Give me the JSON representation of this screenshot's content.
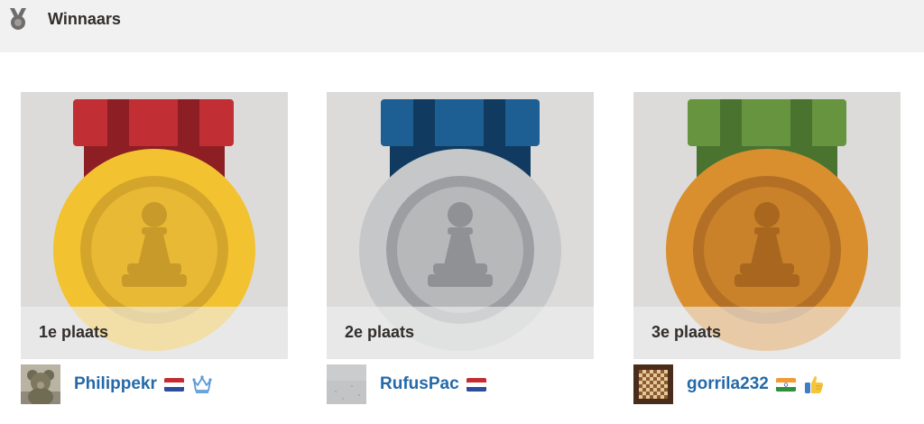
{
  "header": {
    "icon": "medal-icon",
    "title": "Winnaars"
  },
  "colors": {
    "gold": "#f0c23b",
    "silver": "#b9bcbf",
    "bronze": "#d9912f",
    "ribbon_red": "#c12e34",
    "ribbon_blue": "#1c5f93",
    "ribbon_green": "#66933f",
    "username_link": "#2469a8"
  },
  "winners": [
    {
      "place_label": "1e plaats",
      "medal": "gold-medal-pawn-icon",
      "username": "Philippekr",
      "avatar": "teddy-bear-avatar",
      "flag": "netherlands-flag-icon",
      "badge": "crown-icon"
    },
    {
      "place_label": "2e plaats",
      "medal": "silver-medal-pawn-icon",
      "username": "RufusPac",
      "avatar": "gray-texture-avatar",
      "flag": "netherlands-flag-icon"
    },
    {
      "place_label": "3e plaats",
      "medal": "bronze-medal-pawn-icon",
      "username": "gorrila232",
      "avatar": "chessboard-avatar",
      "flag": "india-flag-icon",
      "badge": "thumbs-up-icon"
    }
  ]
}
